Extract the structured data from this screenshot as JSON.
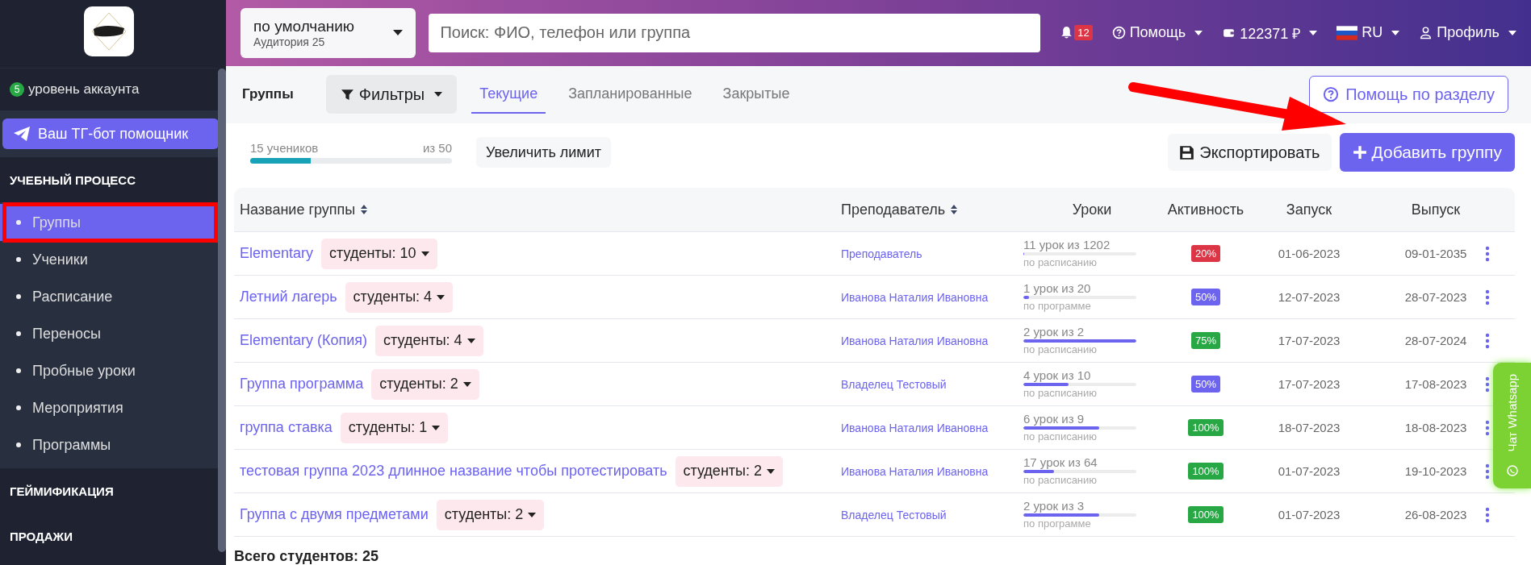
{
  "sidebar": {
    "level_badge": "5",
    "level_label": "уровень аккаунта",
    "bot_button": "Ваш ТГ-бот помощник",
    "sections": [
      {
        "title": "УЧЕБНЫЙ ПРОЦЕСС",
        "items": [
          {
            "label": "Группы",
            "selected": true
          },
          {
            "label": "Ученики",
            "selected": false
          },
          {
            "label": "Расписание",
            "selected": false
          },
          {
            "label": "Переносы",
            "selected": false
          },
          {
            "label": "Пробные уроки",
            "selected": false
          },
          {
            "label": "Мероприятия",
            "selected": false
          },
          {
            "label": "Программы",
            "selected": false
          }
        ]
      },
      {
        "title": "ГЕЙМИФИКАЦИЯ"
      },
      {
        "title": "ПРОДАЖИ"
      }
    ]
  },
  "topbar": {
    "room_select": {
      "value": "по умолчанию",
      "subtitle": "Аудитория 25"
    },
    "search": {
      "placeholder": "Поиск: ФИО, телефон или группа"
    },
    "notifications": "12",
    "help": "Помощь",
    "balance": "122371 ₽",
    "language": "RU",
    "profile": "Профиль"
  },
  "page": {
    "title": "Группы",
    "filters": "Фильтры",
    "tabs": [
      {
        "label": "Текущие",
        "selected": true
      },
      {
        "label": "Запланированные",
        "selected": false
      },
      {
        "label": "Закрытые",
        "selected": false
      }
    ],
    "help_button": "Помощь по разделу"
  },
  "limit": {
    "count": "15 учеников",
    "max": "из 50",
    "level": 0.3,
    "button": "Увеличить лимит"
  },
  "export_button": "Экспортировать",
  "add_button": "Добавить группу",
  "table": {
    "columns": [
      {
        "label": "Название группы",
        "sortable": true
      },
      {
        "label": "Преподаватель",
        "sortable": true
      },
      {
        "label": "Уроки",
        "sortable": false
      },
      {
        "label": "Активность",
        "sortable": false
      },
      {
        "label": "Запуск",
        "sortable": false
      },
      {
        "label": "Выпуск",
        "sortable": false
      }
    ],
    "rows": [
      {
        "name": "Elementary",
        "students": "студенты: 10",
        "teacher": "Преподаватель",
        "lessons": "11 урок из 1202",
        "level": 0.01,
        "mode": "по расписанию",
        "activity": "20%",
        "color": "#dc3545",
        "start": "01-06-2023",
        "end": "09-01-2035"
      },
      {
        "name": "Летний лагерь",
        "students": "студенты: 4",
        "teacher": "Иванова Наталия Ивановна",
        "lessons": "1 урок из 20",
        "level": 0.05,
        "mode": "по программе",
        "activity": "50%",
        "color": "#6c63ef",
        "start": "12-07-2023",
        "end": "28-07-2023"
      },
      {
        "name": "Elementary (Копия)",
        "students": "студенты: 4",
        "teacher": "Иванова Наталия Ивановна",
        "lessons": "2 урок из 2",
        "level": 1,
        "mode": "по расписанию",
        "activity": "75%",
        "color": "#28a745",
        "start": "17-07-2023",
        "end": "28-07-2024"
      },
      {
        "name": "Группа программа",
        "students": "студенты: 2",
        "teacher": "Владелец Тестовый",
        "lessons": "4 урок из 10",
        "level": 0.4,
        "mode": "по расписанию",
        "activity": "50%",
        "color": "#6c63ef",
        "start": "17-07-2023",
        "end": "17-08-2023"
      },
      {
        "name": "группа ставка",
        "students": "студенты: 1",
        "teacher": "Иванова Наталия Ивановна",
        "lessons": "6 урок из 9",
        "level": 0.67,
        "mode": "по расписанию",
        "activity": "100%",
        "color": "#28a745",
        "start": "18-07-2023",
        "end": "18-08-2023"
      },
      {
        "name": "тестовая группа 2023 длинное название чтобы протестировать",
        "students": "студенты: 2",
        "teacher": "Иванова Наталия Ивановна",
        "lessons": "17 урок из 64",
        "level": 0.27,
        "mode": "по расписанию",
        "activity": "100%",
        "color": "#28a745",
        "start": "01-07-2023",
        "end": "19-10-2023"
      },
      {
        "name": "Группа с двумя предметами",
        "students": "студенты: 2",
        "teacher": "Владелец Тестовый",
        "lessons": "2 урок из 3",
        "level": 0.67,
        "mode": "по программе",
        "activity": "100%",
        "color": "#28a745",
        "start": "01-07-2023",
        "end": "26-08-2023"
      }
    ]
  },
  "total": "Всего студентов: 25",
  "chat_tab": "Чат Whatsapp"
}
